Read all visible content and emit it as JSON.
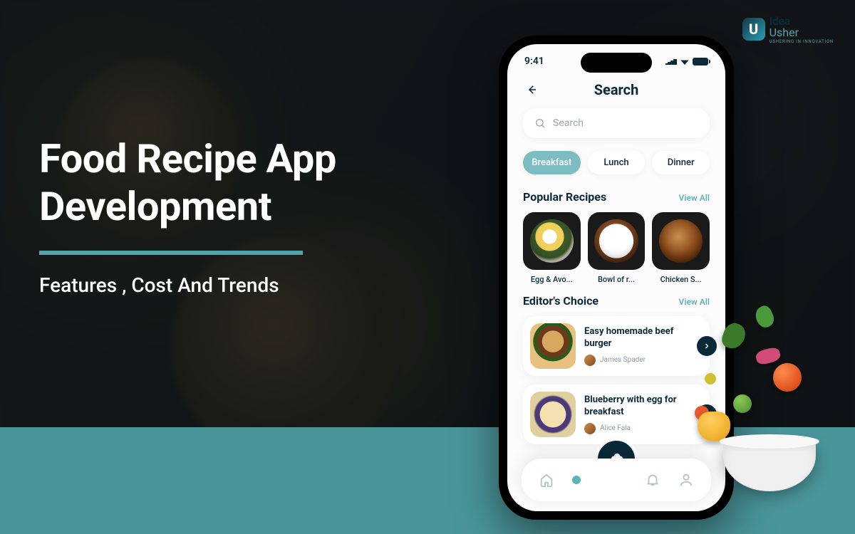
{
  "logo": {
    "brand1": "Idea",
    "brand2": "Usher",
    "tagline": "USHERING IN INNOVATION"
  },
  "hero": {
    "title_line1": "Food Recipe App",
    "title_line2": "Development",
    "subtitle": "Features , Cost And Trends"
  },
  "phone": {
    "status_time": "9:41",
    "header_title": "Search",
    "search_placeholder": "Search",
    "tabs": [
      {
        "label": "Breakfast",
        "active": true
      },
      {
        "label": "Lunch",
        "active": false
      },
      {
        "label": "Dinner",
        "active": false
      }
    ],
    "popular": {
      "title": "Popular Recipes",
      "view_all": "View All",
      "items": [
        {
          "label": "Egg & Avo..."
        },
        {
          "label": "Bowl of r..."
        },
        {
          "label": "Chicken S..."
        }
      ]
    },
    "editors": {
      "title": "Editor's Choice",
      "view_all": "View All",
      "items": [
        {
          "title": "Easy homemade beef burger",
          "author": "James Spader"
        },
        {
          "title": "Blueberry with egg for breakfast",
          "author": "Alice Fala"
        }
      ]
    }
  }
}
